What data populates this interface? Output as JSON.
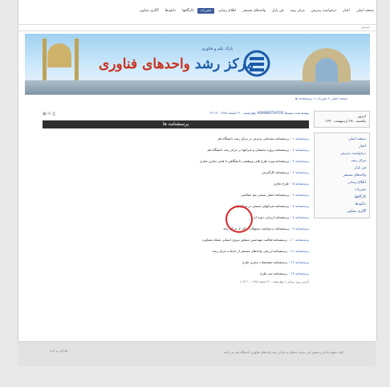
{
  "topnav": {
    "items": [
      "صفحه اصلی",
      "اخبار",
      "درخواست پذیرش",
      "مرکز رشد",
      "فن بازار",
      "واحدهای مستقر",
      "اطلاع رسانی",
      "مقررات",
      "کارگاهها",
      "دانلودها",
      "گالری تصاویر"
    ],
    "active_index": 7
  },
  "subbar": {
    "text": "جستجو"
  },
  "banner": {
    "brand_part1": "مرکز رشد",
    "brand_part2": "واحدهای فناوری",
    "subtitle": "پارک علم و فناوری"
  },
  "breadcrumb": "صفحه اصلی » مقررات » پرسشنامه ها",
  "sidebar": {
    "date_lines": [
      "امروز",
      "یکشنبه ، ۲۸ اردیبهشت ۱۳۹۰"
    ],
    "menu": [
      "صفحه اصلی",
      "اخبار",
      "درخواست پذیرش",
      "مرکز رشد",
      "فن بازار",
      "واحدهای مستقر",
      "اطلاع رسانی",
      "مقررات",
      "کارگاهها",
      "دانلودها",
      "گالری تصاویر"
    ]
  },
  "article": {
    "meta": "نوشته شده توسط ADMINISTRATOR   چهارشنبه ، ۲۱ اسفند ۱۳۸۷ ، ۱۳:۱۹",
    "icons": "▣ ✉ ⎙",
    "title": "پرسشنامه ها",
    "items": [
      {
        "link": "پرسشنامه ۱ :",
        "text": "پرسشنامه مقدماتی پذیرش در مرکز رشد دانشگاه قم"
      },
      {
        "link": "پرسشنامه ۲ :",
        "text": "پرسشنامه پروژه محققان و شرکتها در مرکز رشد دانشگاه قم"
      },
      {
        "link": "پرسشنامه ۳ :",
        "text": "پرسشنامه ویژه طرح های پژوهشی دانشگاهی با هدف تجاری سازی"
      },
      {
        "link": "پرسشنامه ۴ :",
        "text": "پرسشنامه کارآفرینی"
      },
      {
        "link": "پرسشنامه ۵ :",
        "text": "طرح تجاری"
      },
      {
        "link": "پرسشنامه ۶ :",
        "text": "پرسشنامه اعتبار سنجی تیم متقاضی"
      },
      {
        "link": "پرسشنامه ۷ :",
        "text": "پرسشنامه شرکتهای مستقر در مرکز رشد"
      },
      {
        "link": "پرسشنامه ۸ :",
        "text": "پرسشنامه ارزیابی دوره ای"
      },
      {
        "link": "پرسشنامه ۹ :",
        "text": "پرسشنامه درخواست تسهیلات مالی از مرکز رشد"
      },
      {
        "link": "پرسشنامه ۱۰ :",
        "text": "پرسشنامه فعالیت مهندسین مشاور نیروی انسانی شبکه مشاوره"
      },
      {
        "link": "پرسشنامه ۱۱ :",
        "text": "پرسشنامه ارزیابی واحدهای مستقر از خدمات مرکز رشد"
      },
      {
        "link": "پرسشنامه ۱۲ :",
        "text": "پرسشنامه مشخصات مجری طرح"
      },
      {
        "link": "پرسشنامه ۱۳ :",
        "text": "پرسشنامه ثبت طرح"
      }
    ],
    "updated": "آخرین بروز رسانی ( چهارشنبه ، ۲۱ اسفند ۱۳۸۷ ، ۱۳:۲۰ )"
  },
  "footer": {
    "right": "کلیه حقوق مادی و معنوی این سایت متعلق به مرکز رشد واحدهای فناوری دانشگاه قم می باشد",
    "left": "طراحی و اجرا"
  }
}
